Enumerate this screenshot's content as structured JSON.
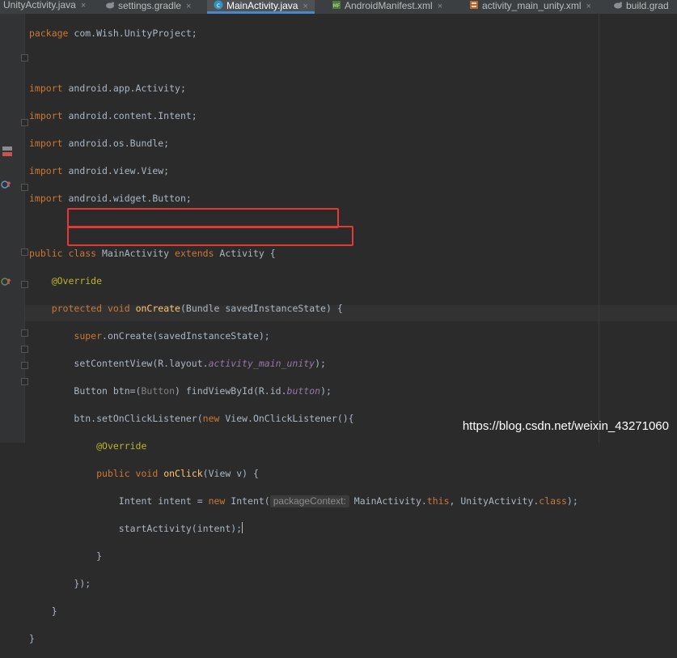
{
  "tabs": [
    {
      "label": "UnityActivity.java",
      "active": false,
      "icon": "none"
    },
    {
      "label": "settings.gradle",
      "active": false,
      "icon": "gradle-icon"
    },
    {
      "label": "MainActivity.java",
      "active": true,
      "icon": "java-class-icon"
    },
    {
      "label": "AndroidManifest.xml",
      "active": false,
      "icon": "manifest-icon"
    },
    {
      "label": "activity_main_unity.xml",
      "active": false,
      "icon": "layout-xml-icon"
    },
    {
      "label": "build.grad",
      "active": false,
      "icon": "gradle-icon"
    }
  ],
  "tab_close_glyph": "×",
  "code": {
    "package": {
      "kw": "package",
      "rest": " com.Wish.UnityProject;"
    },
    "imports": [
      {
        "kw": "import",
        "rest": " android.app.Activity;"
      },
      {
        "kw": "import",
        "rest": " android.content.Intent;"
      },
      {
        "kw": "import",
        "rest": " android.os.Bundle;"
      },
      {
        "kw": "import",
        "rest": " android.view.View;"
      },
      {
        "kw": "import",
        "rest": " android.widget.Button;"
      }
    ],
    "class_decl": {
      "kw1": "public class",
      "name": " MainActivity ",
      "kw2": "extends",
      "rest": " Activity {"
    },
    "override1": "@Override",
    "oncreate": {
      "kw": "protected void",
      "fn": "onCreate",
      "rest": "(Bundle savedInstanceState) {"
    },
    "super_call": {
      "kw": "super",
      "rest": ".onCreate(savedInstanceState);"
    },
    "set_content": {
      "pre": "setContentView(R.layout.",
      "field": "activity_main_unity",
      "post": ");"
    },
    "button_line": {
      "pre": "Button btn=(",
      "cast": "Button",
      "mid": ") findViewById(R.id.",
      "field": "button",
      "post": ");"
    },
    "listener": {
      "pre": "btn.setOnClickListener(",
      "kw": "new",
      "rest": " View.OnClickListener(){"
    },
    "override2": "@Override",
    "onclick": {
      "kw": "public void",
      "fn": "onClick",
      "rest": "(View v) {"
    },
    "intent": {
      "pre": "Intent intent = ",
      "kw": "new",
      "mid": " Intent(",
      "hint": "packageContext:",
      "args1": "MainActivity.",
      "kw2": "this",
      "args2": ", UnityActivity.",
      "kw3": "class",
      "post": ");"
    },
    "start": "startActivity(intent);",
    "close_brace": "}",
    "close_paren": "});",
    "close_method": "}",
    "close_class": "}"
  },
  "watermark": "https://blog.csdn.net/weixin_43271060"
}
